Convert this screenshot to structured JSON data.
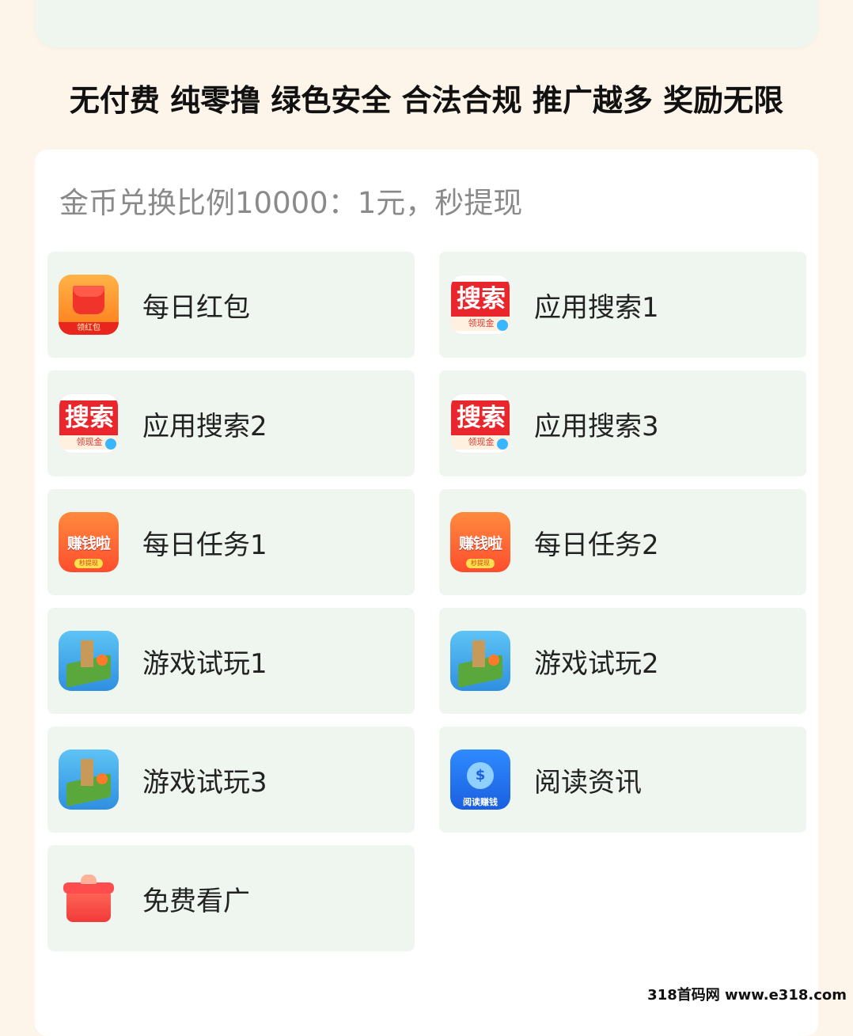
{
  "tagline": "无付费 纯零撸  绿色安全  合法合规  推广越多 奖励无限",
  "exchange_rate": "金币兑换比例10000：1元，秒提现",
  "tiles": [
    {
      "label": "每日红包",
      "icon": "red-packet-icon",
      "icon_text": "领红包"
    },
    {
      "label": "应用搜索1",
      "icon": "search-app-icon",
      "icon_text": "搜索",
      "icon_sub": "领现金"
    },
    {
      "label": "应用搜索2",
      "icon": "search-app-icon",
      "icon_text": "搜索",
      "icon_sub": "领现金"
    },
    {
      "label": "应用搜索3",
      "icon": "search-app-icon",
      "icon_text": "搜索",
      "icon_sub": "领现金"
    },
    {
      "label": "每日任务1",
      "icon": "earn-money-icon",
      "icon_text": "赚钱啦",
      "icon_sub": "秒提现"
    },
    {
      "label": "每日任务2",
      "icon": "earn-money-icon",
      "icon_text": "赚钱啦",
      "icon_sub": "秒提现"
    },
    {
      "label": "游戏试玩1",
      "icon": "game-icon"
    },
    {
      "label": "游戏试玩2",
      "icon": "game-icon"
    },
    {
      "label": "游戏试玩3",
      "icon": "game-icon"
    },
    {
      "label": "阅读资讯",
      "icon": "reading-icon",
      "icon_text": "阅读赚钱"
    },
    {
      "label": "免费看广",
      "icon": "gift-box-icon"
    }
  ],
  "watermark": "318首码网 www.e318.com",
  "colors": {
    "page_bg": "#fdf5ea",
    "tile_bg": "#eef6ef",
    "card_bg": "#ffffff",
    "accent_red": "#e8262b"
  }
}
